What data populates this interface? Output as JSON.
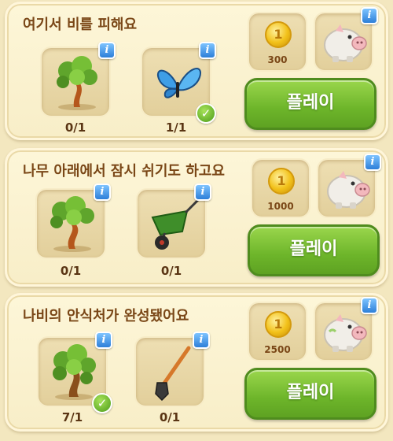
{
  "quests": [
    {
      "title": "여기서 비를 피해요",
      "items": [
        {
          "icon": "tree-icon",
          "progress": "0/1",
          "completed": false
        },
        {
          "icon": "butterfly-icon",
          "progress": "1/1",
          "completed": true
        }
      ],
      "reward_coins": "300",
      "play_label": "플레이"
    },
    {
      "title": "나무 아래에서 잠시 쉬기도 하고요",
      "items": [
        {
          "icon": "tree-icon",
          "progress": "0/1",
          "completed": false
        },
        {
          "icon": "wheelbarrow-icon",
          "progress": "0/1",
          "completed": false
        }
      ],
      "reward_coins": "1000",
      "play_label": "플레이"
    },
    {
      "title": "나비의 안식처가 완성됐어요",
      "items": [
        {
          "icon": "tree-icon",
          "progress": "7/1",
          "completed": true
        },
        {
          "icon": "shovel-icon",
          "progress": "0/1",
          "completed": false
        }
      ],
      "reward_coins": "2500",
      "play_label": "플레이"
    }
  ],
  "info_glyph": "i",
  "check_glyph": "✓",
  "coin_glyph": "1",
  "colors": {
    "background": "#f3e7bf",
    "title_text": "#7a4717",
    "play_button": "#6db52a",
    "info_badge": "#2d7fd8",
    "check_badge": "#4b9b18",
    "coin": "#f2c11a"
  }
}
